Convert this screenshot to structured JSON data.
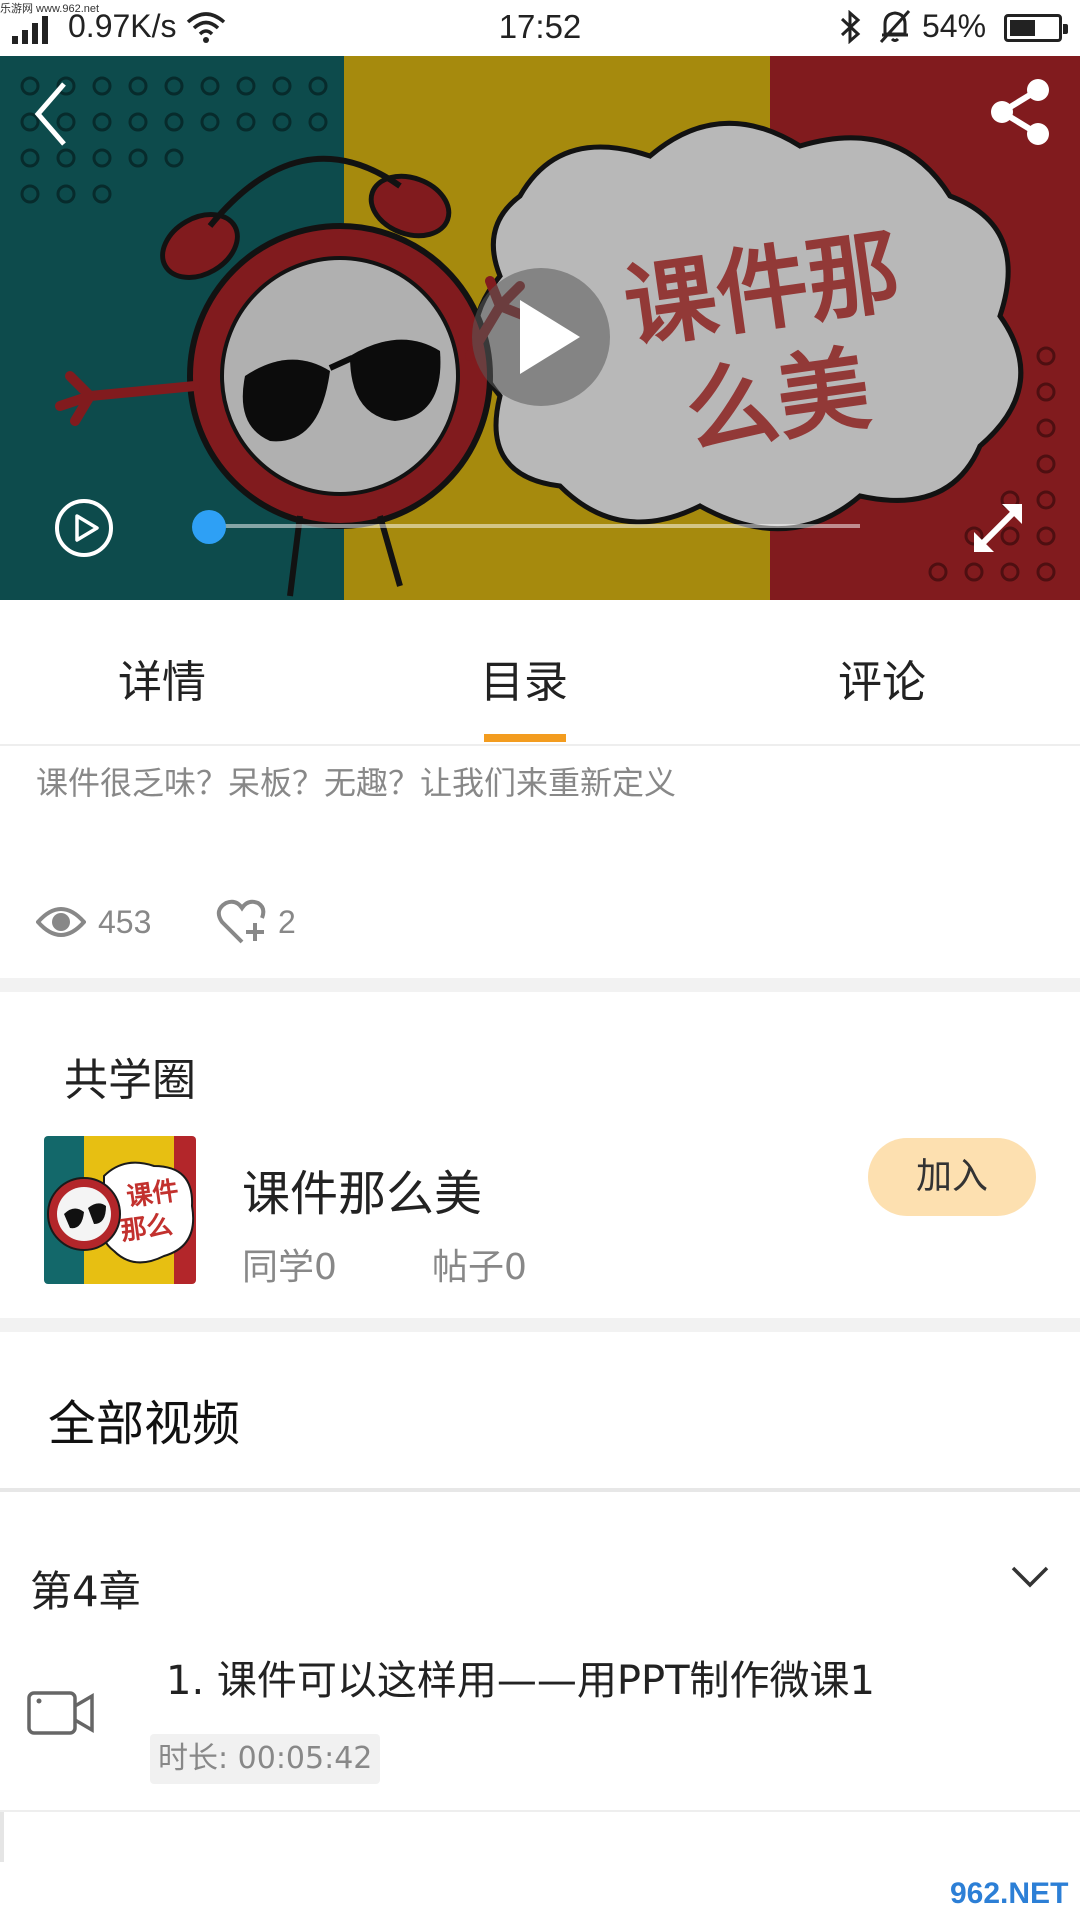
{
  "status_bar": {
    "watermark": "乐游网 www.962.net",
    "network_speed": "0.97K/s",
    "time": "17:52",
    "battery_pct": "54%",
    "battery_level": 0.54
  },
  "video": {
    "thumbnail_title": "课件那么美",
    "progress": 0.0
  },
  "tabs": [
    {
      "label": "详情",
      "selected": false
    },
    {
      "label": "目录",
      "selected": true
    },
    {
      "label": "评论",
      "selected": false
    }
  ],
  "description": "课件很乏味？呆板？无趣？让我们来重新定义",
  "stats": {
    "views": "453",
    "likes": "2"
  },
  "circle": {
    "section_title": "共学圈",
    "name": "课件那么美",
    "mates": "同学0",
    "posts": "帖子0",
    "join_label": "加入",
    "thumb_text": "课件那么美"
  },
  "all_videos": {
    "title": "全部视频",
    "chapters": [
      {
        "title": "第4章",
        "lessons": [
          {
            "title": "1. 课件可以这样用——用PPT制作微课1",
            "duration": "时长: 00:05:42"
          }
        ]
      }
    ]
  },
  "watermark_br": "962.NET",
  "colors": {
    "accent": "#f39c1f",
    "join_bg": "#fde0b0",
    "progress_knob": "#2ea0f5"
  },
  "icons": [
    "signal-icon",
    "wifi-icon",
    "bluetooth-icon",
    "bell-muted-icon",
    "battery-icon",
    "back-icon",
    "share-icon",
    "play-icon",
    "play-circle-icon",
    "fullscreen-icon",
    "eye-icon",
    "heart-plus-icon",
    "chevron-down-icon",
    "video-camera-icon"
  ]
}
